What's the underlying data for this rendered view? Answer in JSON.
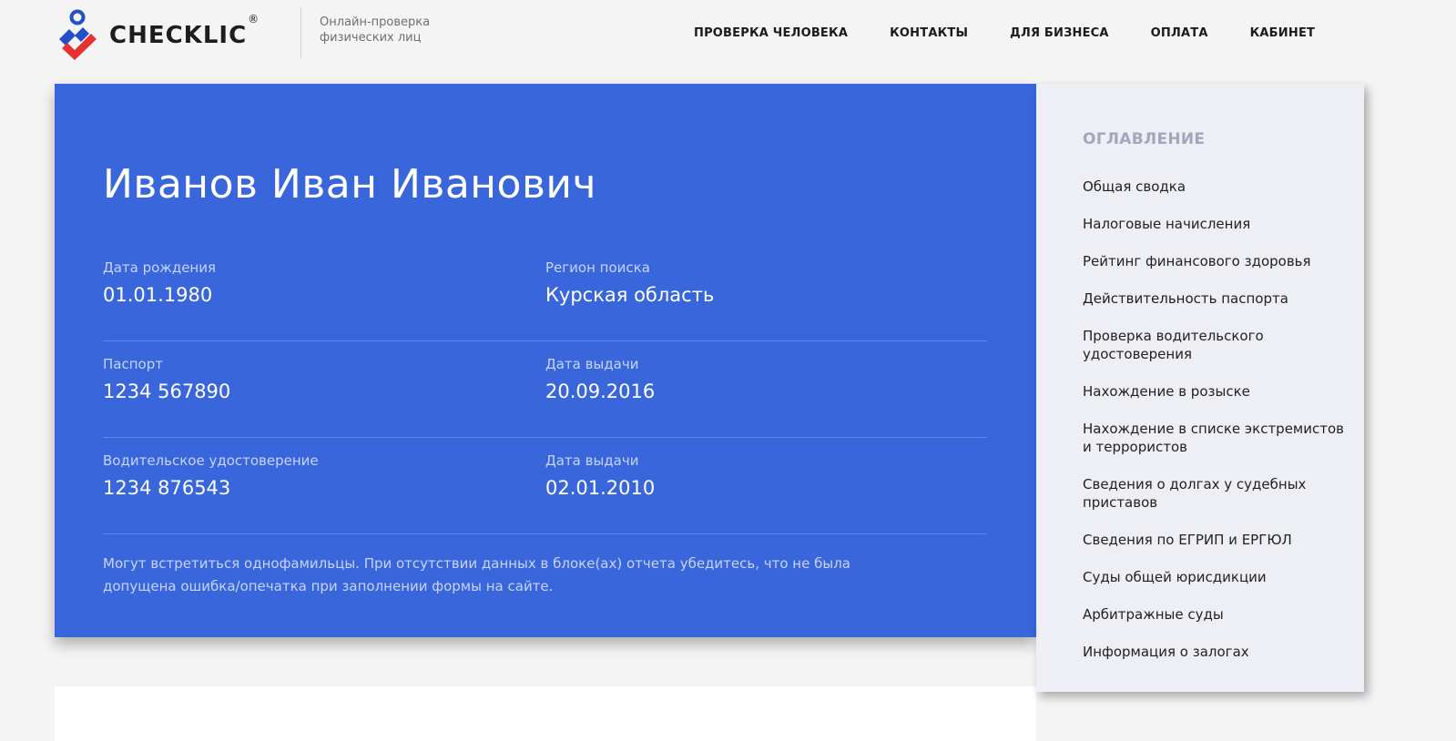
{
  "brand": {
    "name": "CHECKLIC",
    "registered": "®",
    "tagline": "Онлайн-проверка физических лиц",
    "colors": {
      "blue": "#2450c7",
      "red": "#e63331"
    }
  },
  "nav": {
    "items": [
      "ПРОВЕРКА ЧЕЛОВЕКА",
      "КОНТАКТЫ",
      "ДЛЯ БИЗНЕСА",
      "ОПЛАТА",
      "КАБИНЕТ"
    ]
  },
  "profile": {
    "name": "Иванов Иван Иванович",
    "rows": [
      [
        {
          "label": "Дата рождения",
          "value": "01.01.1980"
        },
        {
          "label": "Регион поиска",
          "value": "Курская область"
        }
      ],
      [
        {
          "label": "Паспорт",
          "value": "1234 567890"
        },
        {
          "label": "Дата выдачи",
          "value": "20.09.2016"
        }
      ],
      [
        {
          "label": "Водительское удостоверение",
          "value": "1234 876543"
        },
        {
          "label": "Дата выдачи",
          "value": "02.01.2010"
        }
      ]
    ],
    "disclaimer": "Могут встретиться однофамильцы. При отсутствии данных в блоке(ах) отчета убедитесь, что не была допущена ошибка/опечатка при заполнении формы на сайте.",
    "accent_color": "#3a66db"
  },
  "toc": {
    "title": "ОГЛАВЛЕНИЕ",
    "items": [
      "Общая сводка",
      "Налоговые начисления",
      "Рейтинг финансового здоровья",
      "Действительность паспорта",
      "Проверка водительского удостоверения",
      "Нахождение в розыске",
      "Нахождение в списке экстремистов и террористов",
      "Сведения о долгах у судебных приставов",
      "Сведения по ЕГРИП и ЕРГЮЛ",
      "Суды общей юрисдикции",
      "Арбитражные суды",
      "Информация о залогах"
    ]
  }
}
